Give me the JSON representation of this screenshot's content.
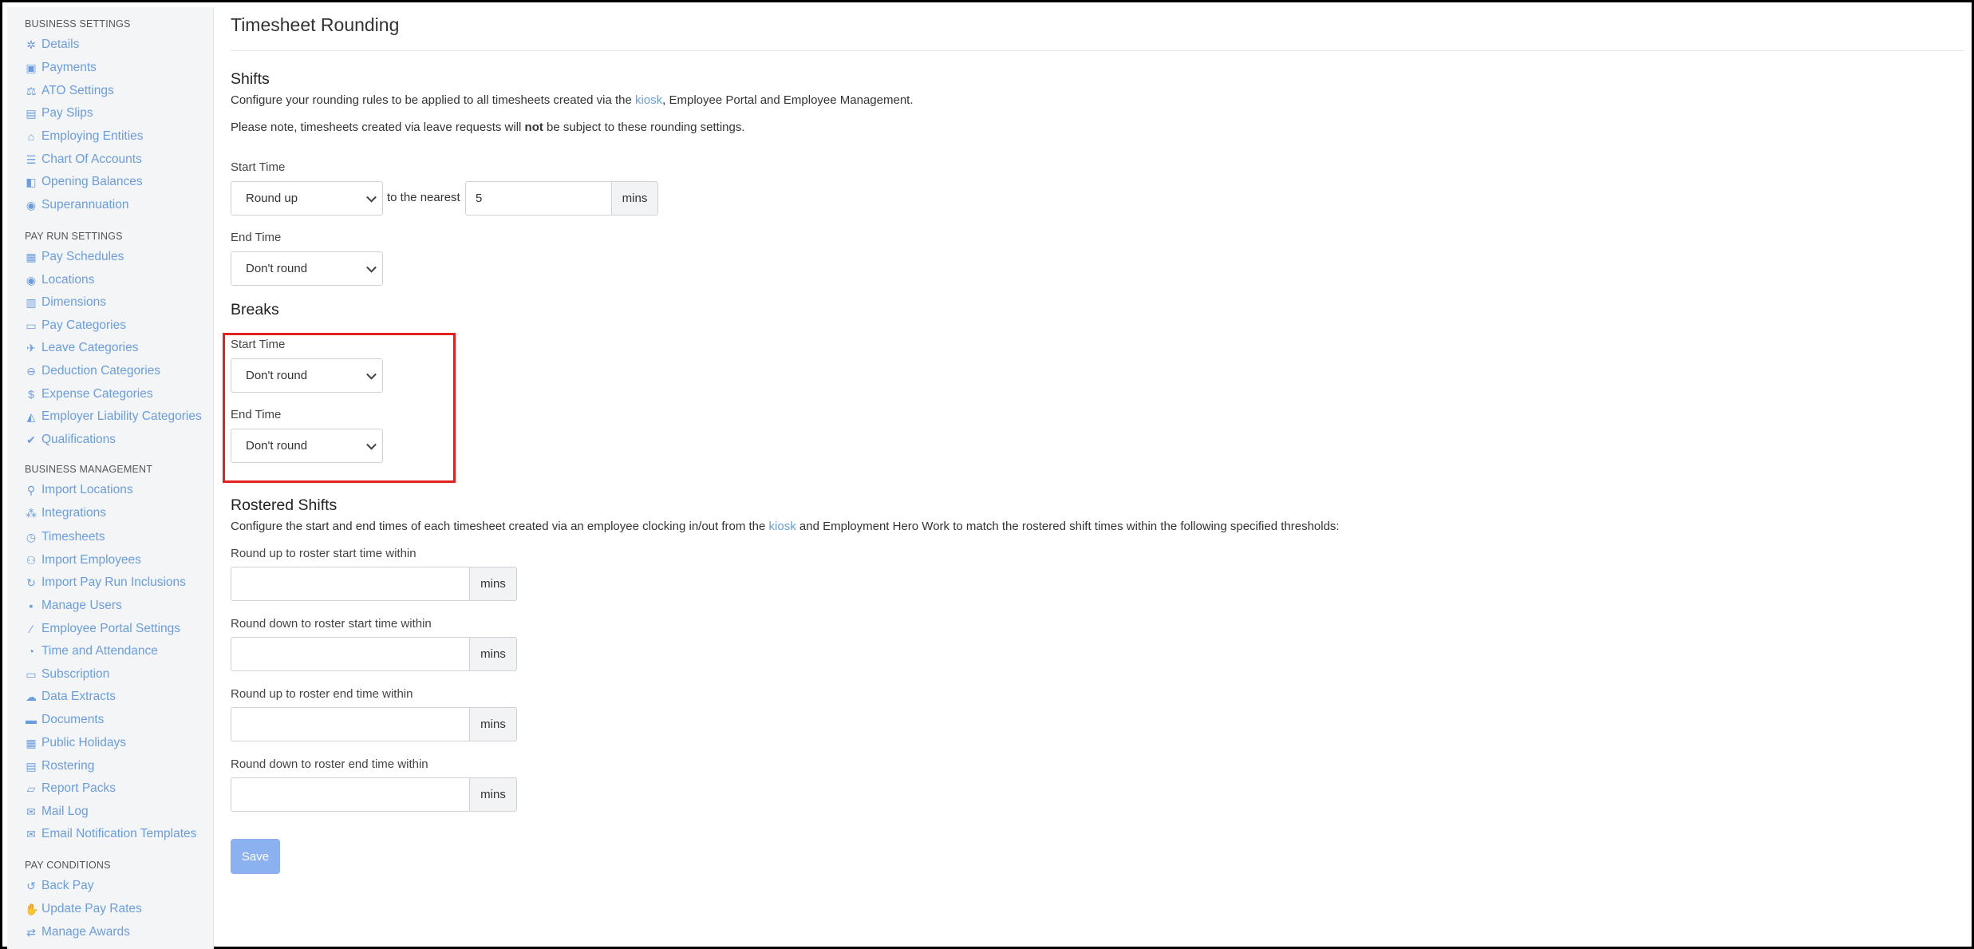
{
  "page": {
    "title": "Timesheet Rounding"
  },
  "sidebar": {
    "sections": [
      {
        "label": "BUSINESS SETTINGS",
        "items": [
          {
            "label": "Details",
            "icon": "gear-icon"
          },
          {
            "label": "Payments",
            "icon": "floppy-icon"
          },
          {
            "label": "ATO Settings",
            "icon": "scale-icon"
          },
          {
            "label": "Pay Slips",
            "icon": "file-icon"
          },
          {
            "label": "Employing Entities",
            "icon": "bank-icon"
          },
          {
            "label": "Chart Of Accounts",
            "icon": "list-icon"
          },
          {
            "label": "Opening Balances",
            "icon": "ledger-icon"
          },
          {
            "label": "Superannuation",
            "icon": "globe-icon"
          }
        ]
      },
      {
        "label": "PAY RUN SETTINGS",
        "items": [
          {
            "label": "Pay Schedules",
            "icon": "calendar-icon"
          },
          {
            "label": "Locations",
            "icon": "globe-icon"
          },
          {
            "label": "Dimensions",
            "icon": "chart-icon"
          },
          {
            "label": "Pay Categories",
            "icon": "money-icon"
          },
          {
            "label": "Leave Categories",
            "icon": "plane-icon"
          },
          {
            "label": "Deduction Categories",
            "icon": "minus-circle-icon"
          },
          {
            "label": "Expense Categories",
            "icon": "dollar-circle-icon"
          },
          {
            "label": "Employer Liability Categories",
            "icon": "area-chart-icon"
          },
          {
            "label": "Qualifications",
            "icon": "check-icon"
          }
        ]
      },
      {
        "label": "BUSINESS MANAGEMENT",
        "items": [
          {
            "label": "Import Locations",
            "icon": "pin-icon"
          },
          {
            "label": "Integrations",
            "icon": "puzzle-icon"
          },
          {
            "label": "Timesheets",
            "icon": "clock-icon"
          },
          {
            "label": "Import Employees",
            "icon": "people-icon"
          },
          {
            "label": "Import Pay Run Inclusions",
            "icon": "refresh-icon"
          },
          {
            "label": "Manage Users",
            "icon": "lock-icon"
          },
          {
            "label": "Employee Portal Settings",
            "icon": "wand-icon"
          },
          {
            "label": "Time and Attendance",
            "icon": "user-clock-icon"
          },
          {
            "label": "Subscription",
            "icon": "card-icon"
          },
          {
            "label": "Data Extracts",
            "icon": "cloud-download-icon"
          },
          {
            "label": "Documents",
            "icon": "folder-icon"
          },
          {
            "label": "Public Holidays",
            "icon": "calendar-icon"
          },
          {
            "label": "Rostering",
            "icon": "calendar-grid-icon"
          },
          {
            "label": "Report Packs",
            "icon": "folder-open-icon"
          },
          {
            "label": "Mail Log",
            "icon": "envelope-icon"
          },
          {
            "label": "Email Notification Templates",
            "icon": "envelope-icon"
          }
        ]
      },
      {
        "label": "PAY CONDITIONS",
        "items": [
          {
            "label": "Back Pay",
            "icon": "history-icon"
          },
          {
            "label": "Update Pay Rates",
            "icon": "hand-money-icon"
          },
          {
            "label": "Manage Awards",
            "icon": "exchange-icon"
          }
        ]
      }
    ]
  },
  "shifts": {
    "heading": "Shifts",
    "desc_pre": "Configure your rounding rules to be applied to all timesheets created via the ",
    "desc_link": "kiosk",
    "desc_post": ", Employee Portal and Employee Management.",
    "note_pre": "Please note, timesheets created via leave requests will ",
    "note_bold": "not",
    "note_post": " be subject to these rounding settings.",
    "start_label": "Start Time",
    "start_value": "Round up",
    "to_nearest": "to the nearest",
    "nearest_value": "5",
    "mins": "mins",
    "end_label": "End Time",
    "end_value": "Don't round"
  },
  "breaks": {
    "heading": "Breaks",
    "start_label": "Start Time",
    "start_value": "Don't round",
    "end_label": "End Time",
    "end_value": "Don't round"
  },
  "rostered": {
    "heading": "Rostered Shifts",
    "desc_pre": "Configure the start and end times of each timesheet created via an employee clocking in/out from the ",
    "desc_link": "kiosk",
    "desc_post": " and Employment Hero Work to match the rostered shift times within the following specified thresholds:",
    "fields": [
      {
        "label": "Round up to roster start time within",
        "value": "",
        "unit": "mins"
      },
      {
        "label": "Round down to roster start time within",
        "value": "",
        "unit": "mins"
      },
      {
        "label": "Round up to roster end time within",
        "value": "",
        "unit": "mins"
      },
      {
        "label": "Round down to roster end time within",
        "value": "",
        "unit": "mins"
      }
    ]
  },
  "save_label": "Save"
}
